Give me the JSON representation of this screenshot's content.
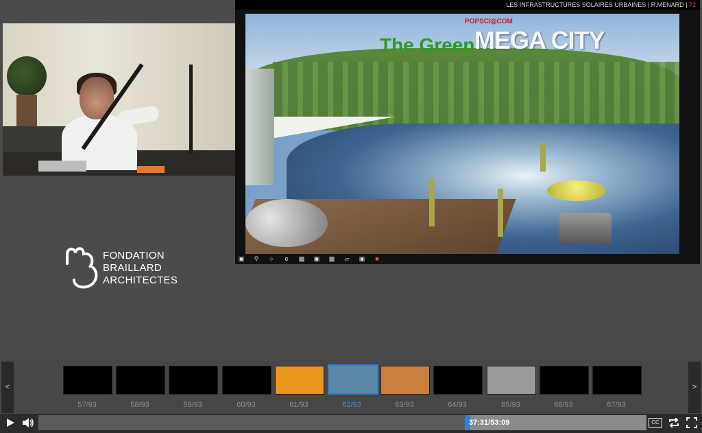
{
  "slide": {
    "header_text": "LES INFRASTRUCTURES SOLAIRES URBAINES | R.MENARD |",
    "header_number": "72",
    "brand_text": "POPSCI◎COM",
    "title_part1": "The Green",
    "title_part2": "MEGA CITY"
  },
  "logo": {
    "line1": "FONDATION",
    "line2": "BRAILLARD",
    "line3": "ARCHITECTES"
  },
  "thumbnails": [
    {
      "label": "57/93",
      "active": false,
      "color": "#000000"
    },
    {
      "label": "58/93",
      "active": false,
      "color": "#000000"
    },
    {
      "label": "59/93",
      "active": false,
      "color": "#000000"
    },
    {
      "label": "60/93",
      "active": false,
      "color": "#000000"
    },
    {
      "label": "61/93",
      "active": false,
      "color": "#e8961c"
    },
    {
      "label": "62/93",
      "active": true,
      "color": "#5d87a6"
    },
    {
      "label": "63/93",
      "active": false,
      "color": "#c9803f"
    },
    {
      "label": "64/93",
      "active": false,
      "color": "#000000"
    },
    {
      "label": "65/93",
      "active": false,
      "color": "#9a9a9a"
    },
    {
      "label": "66/93",
      "active": false,
      "color": "#000000"
    },
    {
      "label": "67/93",
      "active": false,
      "color": "#000000"
    }
  ],
  "nav": {
    "prev": "<",
    "next": ">"
  },
  "player": {
    "time": "37:31/53:09",
    "progress_fraction": 0.7059,
    "cc_label": "CC",
    "play_icon": "play-icon",
    "volume_icon": "volume-icon",
    "loop_icon": "loop-icon",
    "fullscreen_icon": "fullscreen-icon"
  },
  "colors": {
    "accent": "#2f7fd6",
    "active_label": "#3f8fe0",
    "header_number": "#d43a2a"
  }
}
